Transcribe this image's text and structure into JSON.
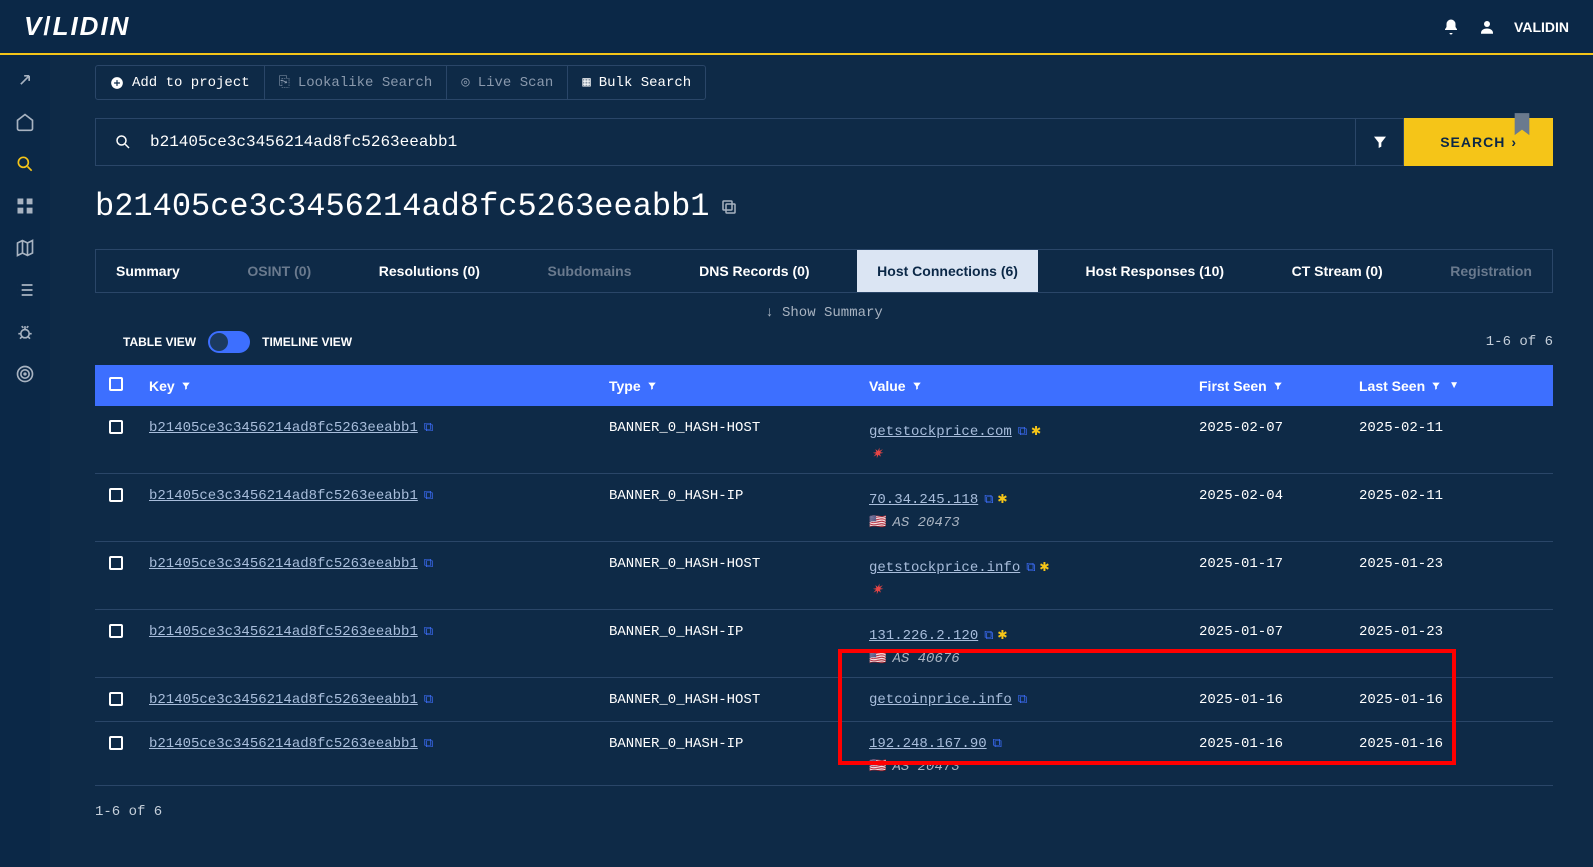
{
  "header": {
    "brand": "VALIDIN",
    "username": "VALIDIN"
  },
  "toolbar": {
    "add_to_project": "Add to project",
    "lookalike_search": "Lookalike Search",
    "live_scan": "Live Scan",
    "bulk_search": "Bulk Search"
  },
  "search": {
    "value": "b21405ce3c3456214ad8fc5263eeabb1",
    "button": "SEARCH"
  },
  "page_title": "b21405ce3c3456214ad8fc5263eeabb1",
  "tabs": {
    "summary": "Summary",
    "osint": "OSINT (0)",
    "resolutions": "Resolutions (0)",
    "subdomains": "Subdomains",
    "dns_records": "DNS Records (0)",
    "host_connections": "Host Connections (6)",
    "host_responses": "Host Responses (10)",
    "ct_stream": "CT Stream (0)",
    "registration": "Registration"
  },
  "show_summary": "↓ Show Summary",
  "view": {
    "table": "TABLE VIEW",
    "timeline": "TIMELINE VIEW"
  },
  "paging_top": "1-6 of 6",
  "paging_bottom": "1-6 of 6",
  "columns": {
    "key": "Key",
    "type": "Type",
    "value": "Value",
    "first_seen": "First Seen",
    "last_seen": "Last Seen"
  },
  "rows": [
    {
      "key": "b21405ce3c3456214ad8fc5263eeabb1",
      "type": "BANNER_0_HASH-HOST",
      "value": "getstockprice.com",
      "star": true,
      "virus": true,
      "asn": "",
      "flag": "",
      "first": "2025-02-07",
      "last": "2025-02-11"
    },
    {
      "key": "b21405ce3c3456214ad8fc5263eeabb1",
      "type": "BANNER_0_HASH-IP",
      "value": "70.34.245.118",
      "star": true,
      "virus": false,
      "asn": "AS 20473",
      "flag": "🇺🇸",
      "first": "2025-02-04",
      "last": "2025-02-11"
    },
    {
      "key": "b21405ce3c3456214ad8fc5263eeabb1",
      "type": "BANNER_0_HASH-HOST",
      "value": "getstockprice.info",
      "star": true,
      "virus": true,
      "asn": "",
      "flag": "",
      "first": "2025-01-17",
      "last": "2025-01-23"
    },
    {
      "key": "b21405ce3c3456214ad8fc5263eeabb1",
      "type": "BANNER_0_HASH-IP",
      "value": "131.226.2.120",
      "star": true,
      "virus": false,
      "asn": "AS 40676",
      "flag": "🇺🇸",
      "first": "2025-01-07",
      "last": "2025-01-23"
    },
    {
      "key": "b21405ce3c3456214ad8fc5263eeabb1",
      "type": "BANNER_0_HASH-HOST",
      "value": "getcoinprice.info",
      "star": false,
      "virus": false,
      "asn": "",
      "flag": "",
      "first": "2025-01-16",
      "last": "2025-01-16"
    },
    {
      "key": "b21405ce3c3456214ad8fc5263eeabb1",
      "type": "BANNER_0_HASH-IP",
      "value": "192.248.167.90",
      "star": false,
      "virus": false,
      "asn": "AS 20473",
      "flag": "🇺🇸",
      "first": "2025-01-16",
      "last": "2025-01-16"
    }
  ]
}
